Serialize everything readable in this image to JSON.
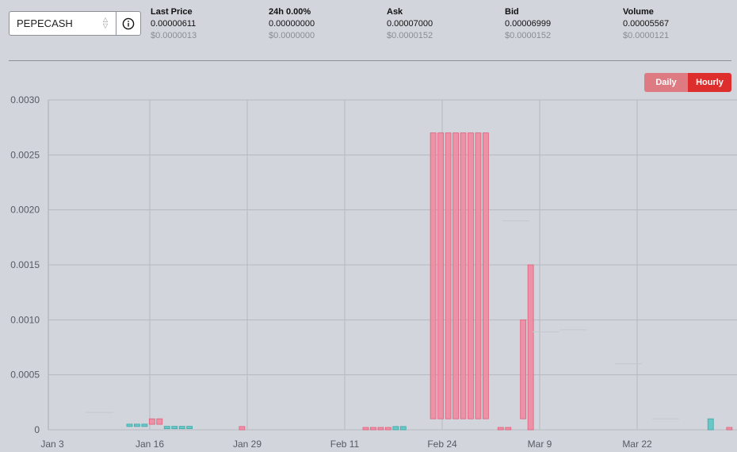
{
  "market": {
    "selected": "PEPECASH"
  },
  "stats": [
    {
      "label": "Last Price",
      "value": "0.00000611",
      "usd": "$0.0000013"
    },
    {
      "label": "24h 0.00%",
      "value": "0.00000000",
      "usd": "$0.0000000"
    },
    {
      "label": "Ask",
      "value": "0.00007000",
      "usd": "$0.0000152"
    },
    {
      "label": "Bid",
      "value": "0.00006999",
      "usd": "$0.0000152"
    },
    {
      "label": "Volume",
      "value": "0.00005567",
      "usd": "$0.0000121"
    }
  ],
  "toggle": {
    "daily_label": "Daily",
    "hourly_label": "Hourly",
    "active": "Hourly"
  },
  "icons": {
    "info": "info-icon",
    "select_chevron": "chevron-updown-icon"
  },
  "colors": {
    "up": "#5cc6c4",
    "down": "#ef8aa0",
    "daily_bg": "#de7a82",
    "hourly_bg": "#dd2d2d"
  },
  "chart_data": {
    "type": "candlestick",
    "title": "",
    "xlabel": "",
    "ylabel": "",
    "ylim": [
      0,
      0.003
    ],
    "y_ticks": [
      "0",
      "0.0005",
      "0.0010",
      "0.0015",
      "0.0020",
      "0.0025",
      "0.0030"
    ],
    "y_tick_values": [
      0,
      0.0005,
      0.001,
      0.0015,
      0.002,
      0.0025,
      0.003
    ],
    "x_ticks": [
      "Jan 3",
      "Jan 16",
      "Jan 29",
      "Feb 11",
      "Feb 24",
      "Mar 9",
      "Mar 22"
    ],
    "x_tick_days": [
      0,
      13,
      26,
      39,
      52,
      65,
      78
    ],
    "x_range_days": [
      -0.5,
      91
    ],
    "grid": true,
    "candles": [
      {
        "day": 6.3,
        "open": 0.000158,
        "close": 0.000158,
        "dir": "flat"
      },
      {
        "day": 10.3,
        "open": 3e-05,
        "close": 4e-05,
        "dir": "up"
      },
      {
        "day": 11.3,
        "open": 3e-05,
        "close": 4e-05,
        "dir": "up"
      },
      {
        "day": 12.3,
        "open": 3e-05,
        "close": 4e-05,
        "dir": "up"
      },
      {
        "day": 13.3,
        "open": 0.0001,
        "close": 5e-05,
        "dir": "down"
      },
      {
        "day": 14.3,
        "open": 0.0001,
        "close": 5e-05,
        "dir": "down"
      },
      {
        "day": 15.3,
        "open": 1e-05,
        "close": 3e-05,
        "dir": "up"
      },
      {
        "day": 16.3,
        "open": 1e-05,
        "close": 3e-05,
        "dir": "up"
      },
      {
        "day": 17.3,
        "open": 1e-05,
        "close": 3e-05,
        "dir": "up"
      },
      {
        "day": 18.3,
        "open": 1e-05,
        "close": 3e-05,
        "dir": "up"
      },
      {
        "day": 25.3,
        "open": 3e-05,
        "close": 0.0,
        "dir": "down"
      },
      {
        "day": 41.8,
        "open": 1.5e-05,
        "close": 0.0,
        "dir": "down"
      },
      {
        "day": 42.8,
        "open": 1.5e-05,
        "close": 0.0,
        "dir": "down"
      },
      {
        "day": 43.8,
        "open": 1.5e-05,
        "close": 0.0,
        "dir": "down"
      },
      {
        "day": 44.8,
        "open": 1.5e-05,
        "close": 0.0,
        "dir": "down"
      },
      {
        "day": 45.8,
        "open": 3e-05,
        "close": 0.0,
        "dir": "up"
      },
      {
        "day": 46.8,
        "open": 3e-05,
        "close": 0.0,
        "dir": "up"
      },
      {
        "day": 50.8,
        "open": 0.0027,
        "close": 0.0001,
        "dir": "down"
      },
      {
        "day": 51.8,
        "open": 0.0027,
        "close": 0.0001,
        "dir": "down"
      },
      {
        "day": 52.8,
        "open": 0.0027,
        "close": 0.0001,
        "dir": "down"
      },
      {
        "day": 53.8,
        "open": 0.0027,
        "close": 0.0001,
        "dir": "down"
      },
      {
        "day": 54.8,
        "open": 0.0027,
        "close": 0.0001,
        "dir": "down"
      },
      {
        "day": 55.8,
        "open": 0.0027,
        "close": 0.0001,
        "dir": "down"
      },
      {
        "day": 56.8,
        "open": 0.0027,
        "close": 0.0001,
        "dir": "down"
      },
      {
        "day": 57.8,
        "open": 0.0027,
        "close": 0.0001,
        "dir": "down"
      },
      {
        "day": 59.8,
        "open": 5e-06,
        "close": 0.0,
        "dir": "down"
      },
      {
        "day": 60.8,
        "open": 5e-06,
        "close": 0.0,
        "dir": "down"
      },
      {
        "day": 61.8,
        "open": 0.0019,
        "close": 0.0019,
        "dir": "flat"
      },
      {
        "day": 62.8,
        "open": 0.001,
        "close": 0.0001,
        "dir": "down"
      },
      {
        "day": 63.8,
        "open": 0.0015,
        "close": 0.0,
        "dir": "down"
      },
      {
        "day": 65.8,
        "open": 0.00089,
        "close": 0.00089,
        "dir": "flat"
      },
      {
        "day": 69.5,
        "open": 0.00091,
        "close": 0.00091,
        "dir": "flat"
      },
      {
        "day": 76.8,
        "open": 0.0006,
        "close": 0.0006,
        "dir": "flat"
      },
      {
        "day": 81.8,
        "open": 0.0001,
        "close": 0.0001,
        "dir": "flat"
      },
      {
        "day": 87.8,
        "open": 0.0001,
        "close": 0.0,
        "dir": "up"
      },
      {
        "day": 90.3,
        "open": 1e-05,
        "close": 0.0,
        "dir": "down"
      }
    ]
  }
}
